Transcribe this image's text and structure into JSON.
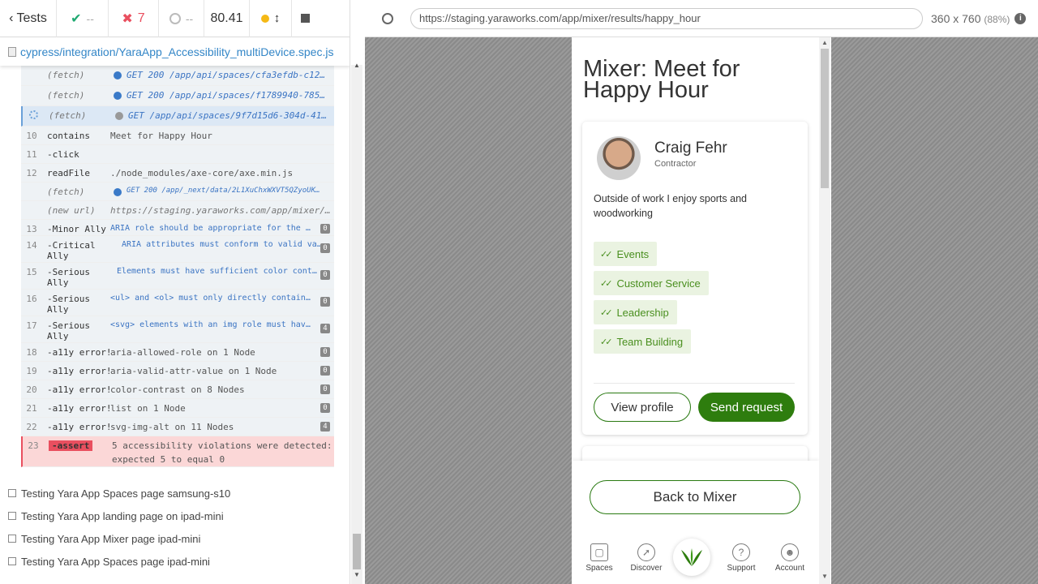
{
  "reporter": {
    "back_label": "Tests",
    "passed": "--",
    "failed": "7",
    "pending": "--",
    "duration": "80.41",
    "spec_path": "cypress/integration/YaraApp_Accessibility_multiDevice.spec.js"
  },
  "commands": [
    {
      "num": "",
      "name": "(fetch)",
      "msg": "GET 200 /app/api/spaces/cfa3efdb-c12…",
      "badge": ""
    },
    {
      "num": "",
      "name": "(fetch)",
      "msg": "GET 200 /app/api/spaces/f1789940-785…",
      "badge": ""
    },
    {
      "num": "",
      "name": "(fetch)",
      "msg": "GET /app/api/spaces/9f7d15d6-304d-41…",
      "badge": ""
    },
    {
      "num": "10",
      "name": "contains",
      "msg": "Meet for Happy Hour",
      "badge": ""
    },
    {
      "num": "11",
      "name": "-click",
      "msg": "",
      "badge": ""
    },
    {
      "num": "12",
      "name": "readFile",
      "msg": "./node_modules/axe-core/axe.min.js",
      "badge": ""
    },
    {
      "num": "",
      "name": "(fetch)",
      "msg": "GET 200 /app/_next/data/2L1XuChxWXVT5QZyoUK…",
      "badge": ""
    },
    {
      "num": "",
      "name": "(new url)",
      "msg": "https://staging.yaraworks.com/app/mixer/…",
      "badge": ""
    },
    {
      "num": "13",
      "name": "-Minor Ally",
      "msg": "ARIA role should be appropriate for the elem…",
      "badge": "0"
    },
    {
      "num": "14",
      "name": "-Critical",
      "name2": "Ally",
      "msg": "ARIA attributes must conform to valid val…",
      "badge": "0"
    },
    {
      "num": "15",
      "name": "-Serious",
      "name2": "Ally",
      "msg": "Elements must have sufficient color contra…",
      "badge": "0"
    },
    {
      "num": "16",
      "name": "-Serious",
      "name2": "Ally",
      "msg": "<ul> and <ol> must only directly contain <li…",
      "badge": "0"
    },
    {
      "num": "17",
      "name": "-Serious",
      "name2": "Ally",
      "msg": "<svg> elements with an img role must have an…",
      "badge": "4"
    },
    {
      "num": "18",
      "name": "-a11y error!",
      "msg": "aria-allowed-role on 1 Node",
      "badge": "0"
    },
    {
      "num": "19",
      "name": "-a11y error!",
      "msg": "aria-valid-attr-value on 1 Node",
      "badge": "0"
    },
    {
      "num": "20",
      "name": "-a11y error!",
      "msg": "color-contrast on 8 Nodes",
      "badge": "0"
    },
    {
      "num": "21",
      "name": "-a11y error!",
      "msg": "list on 1 Node",
      "badge": "0"
    },
    {
      "num": "22",
      "name": "-a11y error!",
      "msg": "svg-img-alt on 11 Nodes",
      "badge": "4"
    },
    {
      "num": "23",
      "name": "-assert",
      "msg": "5 accessibility violations were detected:",
      "msg2": "expected 5 to equal 0",
      "badge": ""
    }
  ],
  "other_tests": [
    "Testing Yara App Spaces page samsung-s10",
    "Testing Yara App landing page on ipad-mini",
    "Testing Yara App Mixer page ipad-mini",
    "Testing Yara App Spaces page ipad-mini"
  ],
  "browser": {
    "url": "https://staging.yaraworks.com/app/mixer/results/happy_hour",
    "viewport": "360 x 760",
    "scale": "(88%)"
  },
  "app": {
    "title": "Mixer: Meet for Happy Hour",
    "person_name": "Craig Fehr",
    "person_role": "Contractor",
    "about": "Outside of work I enjoy sports and woodworking",
    "tags": [
      "Events",
      "Customer Service",
      "Leadership",
      "Team Building"
    ],
    "view_profile": "View profile",
    "send_request": "Send request",
    "back_to_mixer": "Back to Mixer",
    "nav": [
      "Spaces",
      "Discover",
      "Support",
      "Account"
    ],
    "accent_color": "#2e7d0e"
  }
}
